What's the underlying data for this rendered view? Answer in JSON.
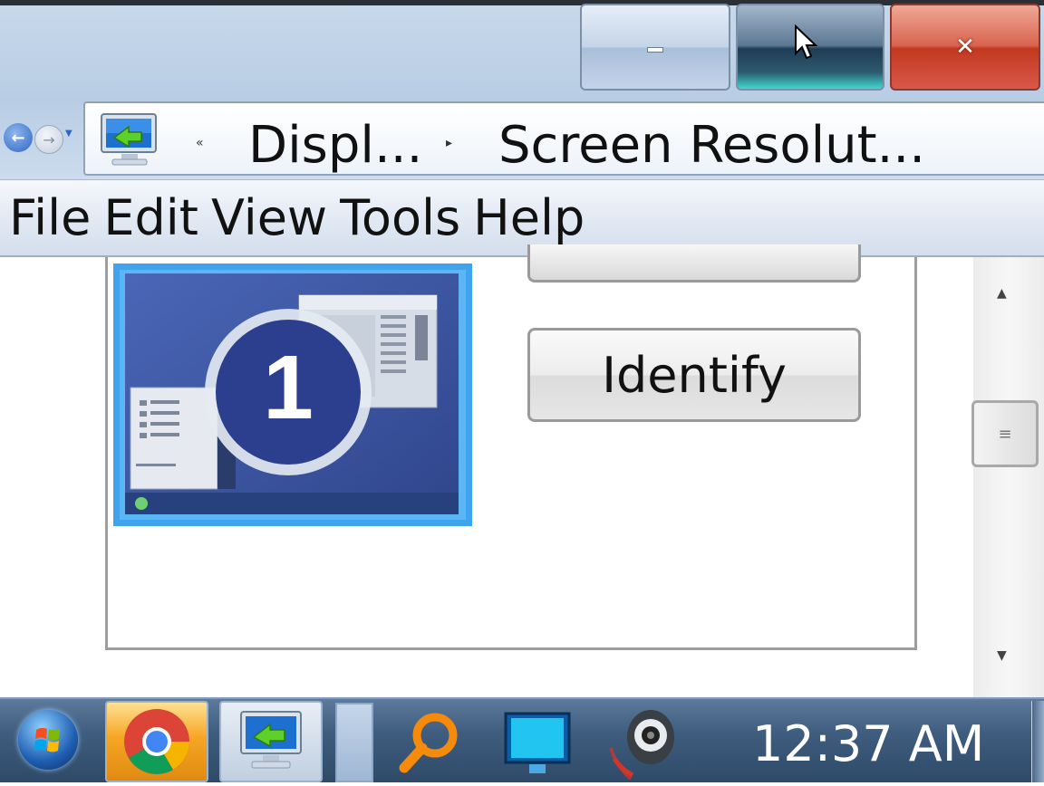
{
  "window": {
    "caption_buttons": {
      "minimize": "minimize",
      "maximize": "maximize",
      "close": "close"
    }
  },
  "nav": {
    "back_icon": "back-arrow-icon",
    "forward_icon": "forward-arrow-icon",
    "history_icon": "chevron-down-icon"
  },
  "address": {
    "overflow_chevron": "«",
    "crumbs": [
      "Displ...",
      "Screen Resolut..."
    ],
    "separator": "▸"
  },
  "menu": {
    "items": [
      "File",
      "Edit",
      "View",
      "Tools",
      "Help"
    ]
  },
  "content": {
    "monitor_number": "1",
    "identify_label": "Identify"
  },
  "scrollbar": {
    "up": "▲",
    "down": "▼",
    "thumb_grip": "≡"
  },
  "taskbar": {
    "clock": "12:37 AM",
    "apps": [
      "chrome-icon",
      "display-settings-icon",
      "search-magnifier-icon",
      "monitor-icon",
      "speaker-icon"
    ]
  },
  "colors": {
    "close_red": "#c2381f",
    "taskbar_blue": "#3f5d7f",
    "monitor_blue": "#3b56a6",
    "accent_cyan": "#3fd7d0"
  }
}
